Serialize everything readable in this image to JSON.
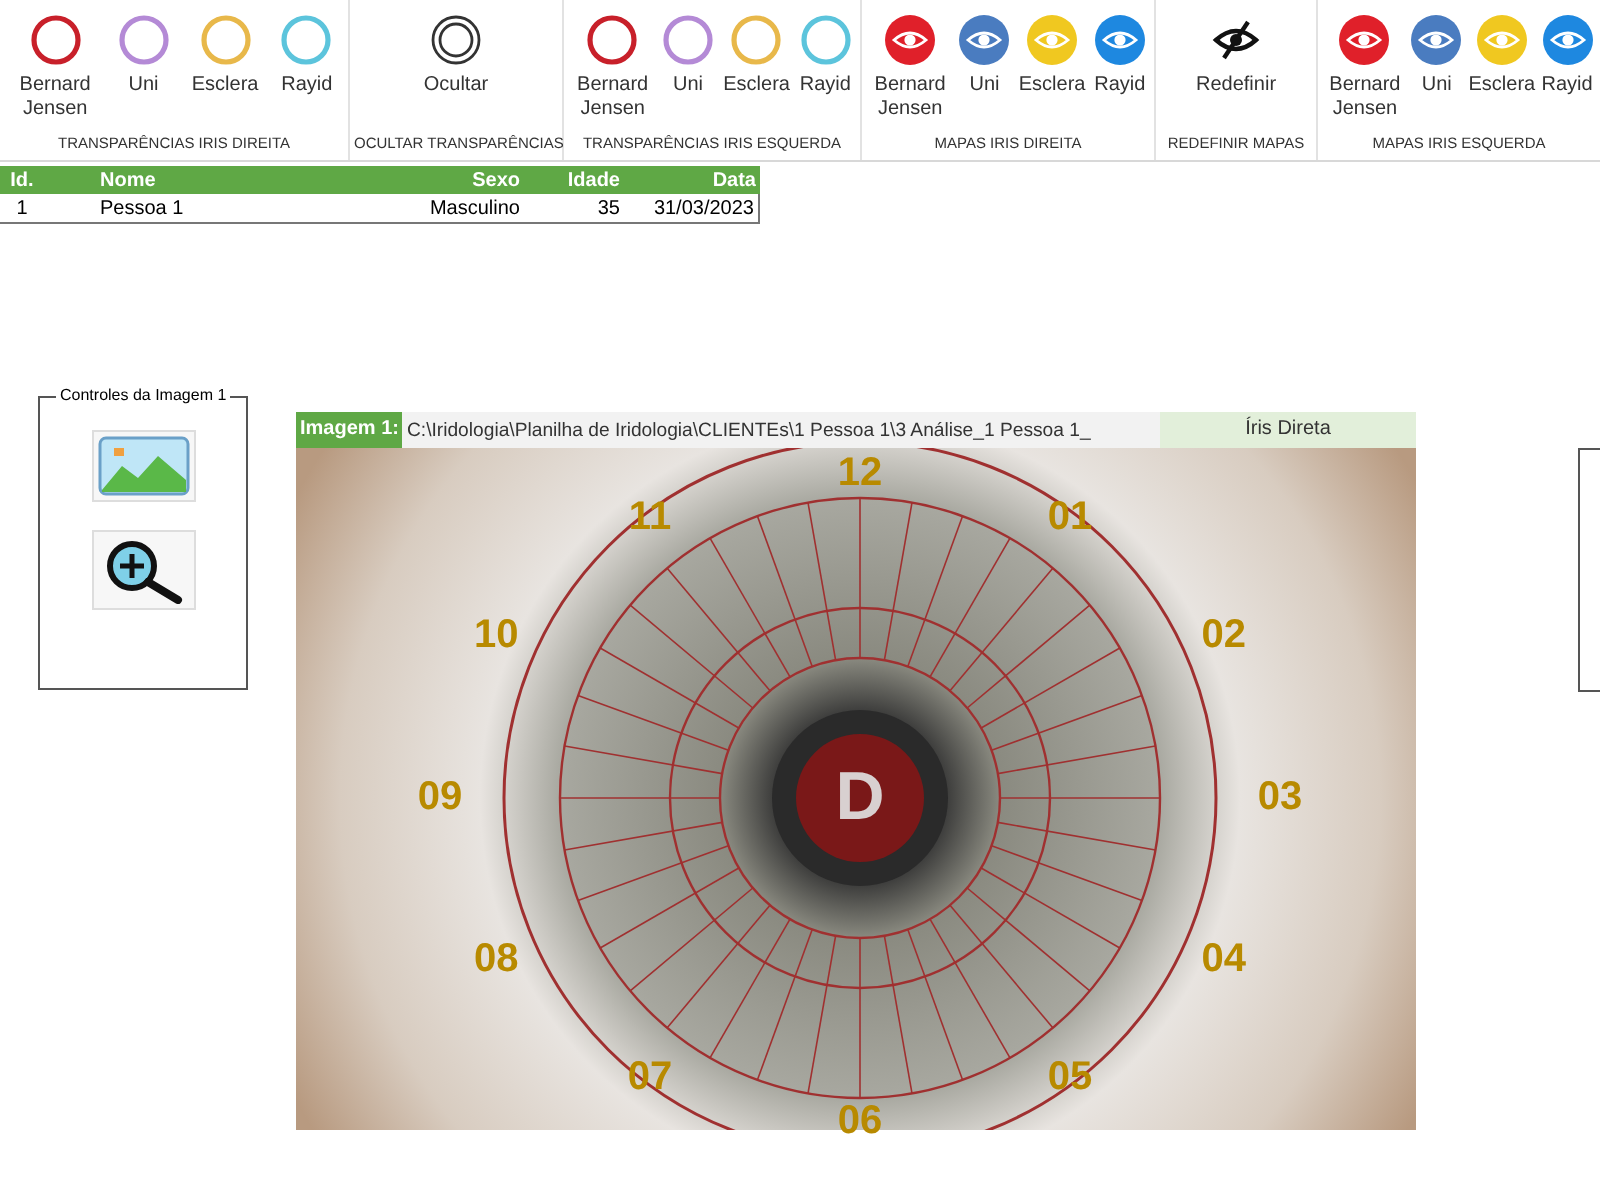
{
  "ribbon": {
    "groups": [
      {
        "label": "TRANSPARÊNCIAS IRIS DIREITA",
        "buttons": [
          {
            "label": "Bernard Jensen",
            "kind": "ring",
            "color": "#c8202a"
          },
          {
            "label": "Uni",
            "kind": "ring",
            "color": "#b48ad6"
          },
          {
            "label": "Esclera",
            "kind": "ring",
            "color": "#e8b84a"
          },
          {
            "label": "Rayid",
            "kind": "ring",
            "color": "#5cc4dc"
          }
        ]
      },
      {
        "label": "OCULTAR TRANSPARÊNCIAS",
        "buttons": [
          {
            "label": "Ocultar",
            "kind": "double-ring",
            "color": "#333333"
          }
        ]
      },
      {
        "label": "TRANSPARÊNCIAS IRIS ESQUERDA",
        "buttons": [
          {
            "label": "Bernard Jensen",
            "kind": "ring",
            "color": "#c8202a"
          },
          {
            "label": "Uni",
            "kind": "ring",
            "color": "#b48ad6"
          },
          {
            "label": "Esclera",
            "kind": "ring",
            "color": "#e8b84a"
          },
          {
            "label": "Rayid",
            "kind": "ring",
            "color": "#5cc4dc"
          }
        ]
      },
      {
        "label": "MAPAS IRIS DIREITA",
        "buttons": [
          {
            "label": "Bernard Jensen",
            "kind": "eye",
            "color": "#e0202a"
          },
          {
            "label": "Uni",
            "kind": "eye",
            "color": "#4a7cc0"
          },
          {
            "label": "Esclera",
            "kind": "eye",
            "color": "#f0c820"
          },
          {
            "label": "Rayid",
            "kind": "eye",
            "color": "#1e88e0"
          }
        ]
      },
      {
        "label": "REDEFINIR MAPAS",
        "buttons": [
          {
            "label": "Redefinir",
            "kind": "hide",
            "color": "#111111"
          }
        ]
      },
      {
        "label": "MAPAS IRIS ESQUERDA",
        "buttons": [
          {
            "label": "Bernard Jensen",
            "kind": "eye",
            "color": "#e0202a"
          },
          {
            "label": "Uni",
            "kind": "eye",
            "color": "#4a7cc0"
          },
          {
            "label": "Esclera",
            "kind": "eye",
            "color": "#f0c820"
          },
          {
            "label": "Rayid",
            "kind": "eye",
            "color": "#1e88e0"
          }
        ]
      }
    ]
  },
  "table": {
    "columns": [
      "Id.",
      "Nome",
      "Sexo",
      "Idade",
      "Data"
    ],
    "rows": [
      [
        "1",
        "Pessoa 1",
        "Masculino",
        "35",
        "31/03/2023"
      ]
    ]
  },
  "controls": {
    "title": "Controles da Imagem 1",
    "buttons": [
      {
        "kind": "image"
      },
      {
        "kind": "zoom"
      }
    ]
  },
  "image_panel": {
    "label": "Imagem 1:",
    "path": "C:\\Iridologia\\Planilha de Iridologia\\CLIENTEs\\1 Pessoa 1\\3 Análise_1 Pessoa 1_",
    "side": "Íris Direta",
    "center_mark": "D",
    "clock_labels": [
      "12",
      "01",
      "02",
      "03",
      "04",
      "05",
      "06",
      "07",
      "08",
      "09",
      "10",
      "11"
    ]
  }
}
